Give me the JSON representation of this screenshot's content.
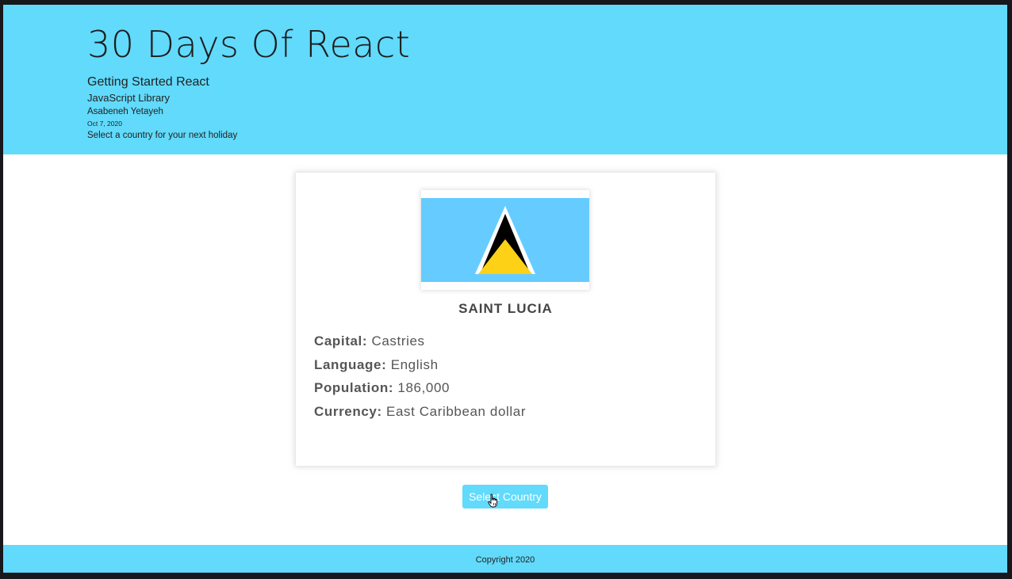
{
  "header": {
    "title": "30 Days Of React",
    "subtitle": "Getting Started React",
    "library": "JavaScript Library",
    "author": "Asabeneh Yetayeh",
    "date": "Oct 7, 2020",
    "tagline": "Select a country for your next holiday"
  },
  "country": {
    "name": "SAINT LUCIA",
    "flag_icon": "saint-lucia-flag",
    "fields": [
      {
        "label": "Capital:",
        "value": "Castries"
      },
      {
        "label": "Language:",
        "value": "English"
      },
      {
        "label": "Population:",
        "value": "186,000"
      },
      {
        "label": "Currency:",
        "value": "East Caribbean dollar"
      }
    ]
  },
  "action": {
    "select_label": "Select Country"
  },
  "footer": {
    "copyright": "Copyright 2020"
  },
  "colors": {
    "brand": "#61dafb",
    "flag_blue": "#66ccff",
    "flag_yellow": "#fcd116"
  }
}
